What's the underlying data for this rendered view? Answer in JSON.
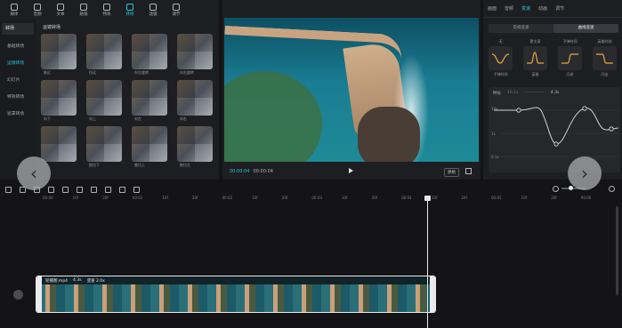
{
  "toolbar": [
    {
      "label": "媒体",
      "icon": "media-icon"
    },
    {
      "label": "音频",
      "icon": "audio-icon"
    },
    {
      "label": "文本",
      "icon": "text-icon"
    },
    {
      "label": "贴纸",
      "icon": "sticker-icon"
    },
    {
      "label": "特效",
      "icon": "effect-icon"
    },
    {
      "label": "转场",
      "icon": "transition-icon",
      "active": true
    },
    {
      "label": "滤镜",
      "icon": "filter-icon"
    },
    {
      "label": "调节",
      "icon": "adjust-icon"
    }
  ],
  "categories": {
    "header": "转场",
    "items": [
      "基础转场",
      "运镜转场",
      "幻灯片",
      "特效转场",
      "遮罩转场"
    ]
  },
  "grid": {
    "title": "运镜转场"
  },
  "tiles": [
    "推近",
    "拉远",
    "向左旋转",
    "向右旋转",
    "向下",
    "向上",
    "向左",
    "向右",
    "",
    "推拉下",
    "推拉上",
    "推拉左"
  ],
  "preview": {
    "time_current": "00:00:04",
    "time_total": "00:00:04",
    "ratio_label": "原始"
  },
  "inspector": {
    "tabs": [
      "画面",
      "音频",
      "变速",
      "动画",
      "调节"
    ],
    "active_tab": "变速",
    "speed_modes": [
      "常规变速",
      "曲线变速"
    ],
    "active_mode": "曲线变速",
    "presets": [
      {
        "top": "无",
        "name": "子弹时间"
      },
      {
        "top": "蒙太奇",
        "name": "英雄"
      },
      {
        "top": "子弹时间",
        "name": "闪进"
      },
      {
        "top": "英雄时刻",
        "name": "闪出"
      }
    ],
    "curve": {
      "label": "时长",
      "from": "10.1s",
      "to": "4.3s",
      "y_top": "10x",
      "y_mid": "1x",
      "y_bot": "0.1x"
    }
  },
  "ruler": [
    "00:00",
    "10f",
    "20f",
    "00:01",
    "10f",
    "20f",
    "00:02",
    "10f",
    "20f",
    "00:03",
    "10f",
    "20f",
    "00:04",
    "10f",
    "20f",
    "00:05",
    "10f",
    "20f",
    "00:06"
  ],
  "clip": {
    "name": "轮播图.mp4",
    "duration": "4.3s",
    "speed": "变速 2.0x"
  },
  "colors": {
    "accent": "#27c4d9",
    "panel": "#1d1e21",
    "background": "#141416"
  }
}
